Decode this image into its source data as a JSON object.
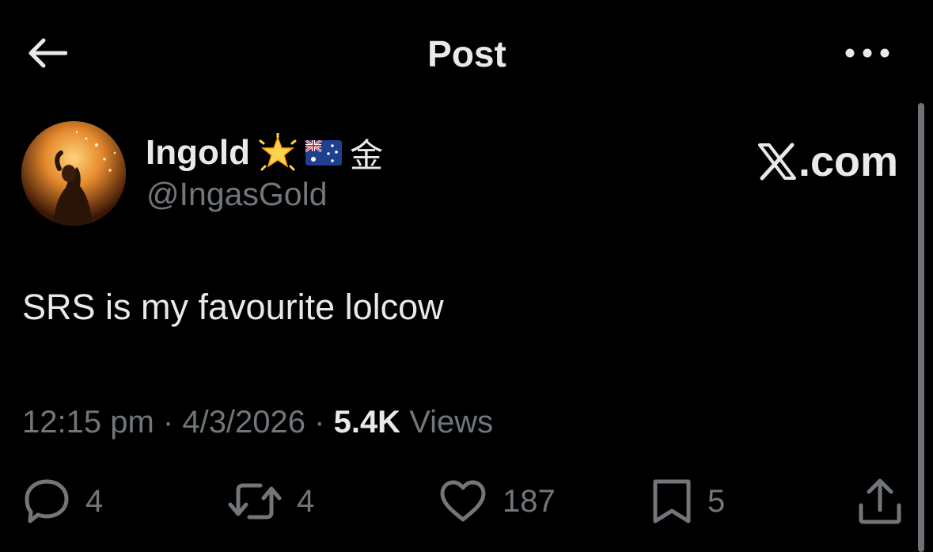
{
  "header": {
    "title": "Post"
  },
  "author": {
    "display_name": "Ingold",
    "name_badges": [
      "glowing-star-icon",
      "australia-flag-icon"
    ],
    "name_suffix": "金",
    "handle": "@IngasGold"
  },
  "watermark": {
    "text": ".com"
  },
  "post": {
    "text": "SRS is my favourite lolcow"
  },
  "meta": {
    "time": "12:15 pm",
    "separator": " · ",
    "date": "4/3/2026",
    "views_count": "5.4K",
    "views_label": " Views"
  },
  "actions": {
    "replies": "4",
    "reposts": "4",
    "likes": "187",
    "bookmarks": "5"
  },
  "colors": {
    "background": "#000000",
    "primary_text": "#e7e9ea",
    "secondary_text": "#71767b"
  }
}
